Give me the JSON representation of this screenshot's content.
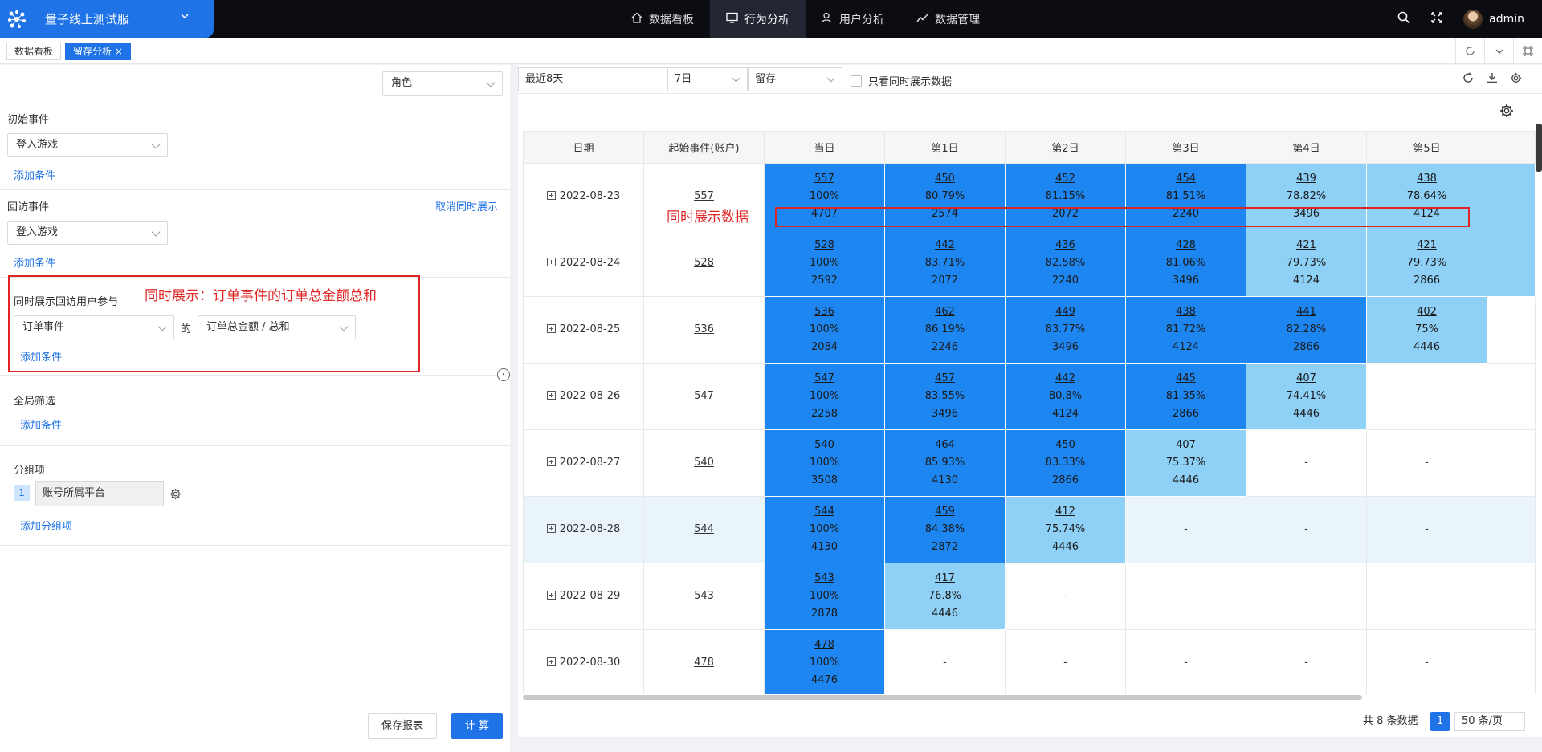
{
  "app": {
    "title": "量子线上测试服",
    "user": "admin"
  },
  "topnav": [
    {
      "label": "数据看板",
      "icon": "home-icon"
    },
    {
      "label": "行为分析",
      "icon": "monitor-icon",
      "active": true
    },
    {
      "label": "用户分析",
      "icon": "user-icon"
    },
    {
      "label": "数据管理",
      "icon": "trend-icon"
    }
  ],
  "page_tabs": [
    {
      "label": "数据看板"
    },
    {
      "label": "留存分析 ×",
      "active": true
    }
  ],
  "left": {
    "role_select": "角色",
    "initial_event": {
      "label": "初始事件",
      "value": "登入游戏",
      "add": "添加条件"
    },
    "return_event": {
      "label": "回访事件",
      "value": "登入游戏",
      "add": "添加条件",
      "cancel": "取消同时展示"
    },
    "simultaneous": {
      "label": "同时展示回访用户参与",
      "event": "订单事件",
      "of": "的",
      "metric": "订单总金额 / 总和",
      "add": "添加条件"
    },
    "annotation_left": "同时展示：订单事件的订单总金额总和",
    "global_filter": {
      "label": "全局筛选",
      "add": "添加条件"
    },
    "group": {
      "label": "分组项",
      "index": "1",
      "value": "账号所属平台",
      "add": "添加分组项"
    },
    "buttons": {
      "save": "保存报表",
      "compute": "计 算"
    }
  },
  "toolbar": {
    "range": "最近8天",
    "period": "7日",
    "type": "留存",
    "only_label": "只看同时展示数据"
  },
  "annotation_table": "同时展示数据",
  "table": {
    "headers": [
      "日期",
      "起始事件(账户)",
      "当日",
      "第1日",
      "第2日",
      "第3日",
      "第4日",
      "第5日"
    ],
    "rows": [
      {
        "date": "2022-08-23",
        "start": "557",
        "cells": [
          {
            "n": "557",
            "p": "100%",
            "v": "4707",
            "c": "dark"
          },
          {
            "n": "450",
            "p": "80.79%",
            "v": "2574",
            "c": "dark"
          },
          {
            "n": "452",
            "p": "81.15%",
            "v": "2072",
            "c": "dark"
          },
          {
            "n": "454",
            "p": "81.51%",
            "v": "2240",
            "c": "dark"
          },
          {
            "n": "439",
            "p": "78.82%",
            "v": "3496",
            "c": "light"
          },
          {
            "n": "438",
            "p": "78.64%",
            "v": "4124",
            "c": "light"
          }
        ],
        "extra": "light"
      },
      {
        "date": "2022-08-24",
        "start": "528",
        "cells": [
          {
            "n": "528",
            "p": "100%",
            "v": "2592",
            "c": "dark"
          },
          {
            "n": "442",
            "p": "83.71%",
            "v": "2072",
            "c": "dark"
          },
          {
            "n": "436",
            "p": "82.58%",
            "v": "2240",
            "c": "dark"
          },
          {
            "n": "428",
            "p": "81.06%",
            "v": "3496",
            "c": "dark"
          },
          {
            "n": "421",
            "p": "79.73%",
            "v": "4124",
            "c": "light"
          },
          {
            "n": "421",
            "p": "79.73%",
            "v": "2866",
            "c": "light"
          }
        ],
        "extra": "light"
      },
      {
        "date": "2022-08-25",
        "start": "536",
        "cells": [
          {
            "n": "536",
            "p": "100%",
            "v": "2084",
            "c": "dark"
          },
          {
            "n": "462",
            "p": "86.19%",
            "v": "2246",
            "c": "dark"
          },
          {
            "n": "449",
            "p": "83.77%",
            "v": "3496",
            "c": "dark"
          },
          {
            "n": "438",
            "p": "81.72%",
            "v": "4124",
            "c": "dark"
          },
          {
            "n": "441",
            "p": "82.28%",
            "v": "2866",
            "c": "dark"
          },
          {
            "n": "402",
            "p": "75%",
            "v": "4446",
            "c": "light"
          }
        ]
      },
      {
        "date": "2022-08-26",
        "start": "547",
        "cells": [
          {
            "n": "547",
            "p": "100%",
            "v": "2258",
            "c": "dark"
          },
          {
            "n": "457",
            "p": "83.55%",
            "v": "3496",
            "c": "dark"
          },
          {
            "n": "442",
            "p": "80.8%",
            "v": "4124",
            "c": "dark"
          },
          {
            "n": "445",
            "p": "81.35%",
            "v": "2866",
            "c": "dark"
          },
          {
            "n": "407",
            "p": "74.41%",
            "v": "4446",
            "c": "light"
          },
          {
            "dash": "-"
          }
        ]
      },
      {
        "date": "2022-08-27",
        "start": "540",
        "cells": [
          {
            "n": "540",
            "p": "100%",
            "v": "3508",
            "c": "dark"
          },
          {
            "n": "464",
            "p": "85.93%",
            "v": "4130",
            "c": "dark"
          },
          {
            "n": "450",
            "p": "83.33%",
            "v": "2866",
            "c": "dark"
          },
          {
            "n": "407",
            "p": "75.37%",
            "v": "4446",
            "c": "light"
          },
          {
            "dash": "-"
          },
          {
            "dash": "-"
          }
        ]
      },
      {
        "date": "2022-08-28",
        "start": "544",
        "hl": true,
        "cells": [
          {
            "n": "544",
            "p": "100%",
            "v": "4130",
            "c": "dark"
          },
          {
            "n": "459",
            "p": "84.38%",
            "v": "2872",
            "c": "dark"
          },
          {
            "n": "412",
            "p": "75.74%",
            "v": "4446",
            "c": "light"
          },
          {
            "dash": "-"
          },
          {
            "dash": "-"
          },
          {
            "dash": "-"
          }
        ]
      },
      {
        "date": "2022-08-29",
        "start": "543",
        "cells": [
          {
            "n": "543",
            "p": "100%",
            "v": "2878",
            "c": "dark"
          },
          {
            "n": "417",
            "p": "76.8%",
            "v": "4446",
            "c": "light"
          },
          {
            "dash": "-"
          },
          {
            "dash": "-"
          },
          {
            "dash": "-"
          },
          {
            "dash": "-"
          }
        ]
      },
      {
        "date": "2022-08-30",
        "start": "478",
        "cells": [
          {
            "n": "478",
            "p": "100%",
            "v": "4476",
            "c": "dark"
          },
          {
            "dash": "-"
          },
          {
            "dash": "-"
          },
          {
            "dash": "-"
          },
          {
            "dash": "-"
          },
          {
            "dash": "-"
          }
        ]
      }
    ]
  },
  "pager": {
    "total": "共 8 条数据",
    "page": "1",
    "size": "50 条/页"
  }
}
